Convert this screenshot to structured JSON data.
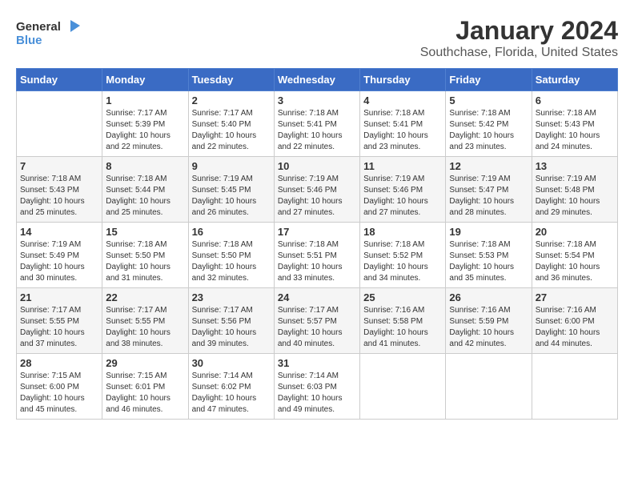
{
  "logo": {
    "name_line1": "General",
    "name_line2": "Blue"
  },
  "title": "January 2024",
  "subtitle": "Southchase, Florida, United States",
  "days_of_week": [
    "Sunday",
    "Monday",
    "Tuesday",
    "Wednesday",
    "Thursday",
    "Friday",
    "Saturday"
  ],
  "weeks": [
    [
      {
        "num": "",
        "info": ""
      },
      {
        "num": "1",
        "info": "Sunrise: 7:17 AM\nSunset: 5:39 PM\nDaylight: 10 hours\nand 22 minutes."
      },
      {
        "num": "2",
        "info": "Sunrise: 7:17 AM\nSunset: 5:40 PM\nDaylight: 10 hours\nand 22 minutes."
      },
      {
        "num": "3",
        "info": "Sunrise: 7:18 AM\nSunset: 5:41 PM\nDaylight: 10 hours\nand 22 minutes."
      },
      {
        "num": "4",
        "info": "Sunrise: 7:18 AM\nSunset: 5:41 PM\nDaylight: 10 hours\nand 23 minutes."
      },
      {
        "num": "5",
        "info": "Sunrise: 7:18 AM\nSunset: 5:42 PM\nDaylight: 10 hours\nand 23 minutes."
      },
      {
        "num": "6",
        "info": "Sunrise: 7:18 AM\nSunset: 5:43 PM\nDaylight: 10 hours\nand 24 minutes."
      }
    ],
    [
      {
        "num": "7",
        "info": "Sunrise: 7:18 AM\nSunset: 5:43 PM\nDaylight: 10 hours\nand 25 minutes."
      },
      {
        "num": "8",
        "info": "Sunrise: 7:18 AM\nSunset: 5:44 PM\nDaylight: 10 hours\nand 25 minutes."
      },
      {
        "num": "9",
        "info": "Sunrise: 7:19 AM\nSunset: 5:45 PM\nDaylight: 10 hours\nand 26 minutes."
      },
      {
        "num": "10",
        "info": "Sunrise: 7:19 AM\nSunset: 5:46 PM\nDaylight: 10 hours\nand 27 minutes."
      },
      {
        "num": "11",
        "info": "Sunrise: 7:19 AM\nSunset: 5:46 PM\nDaylight: 10 hours\nand 27 minutes."
      },
      {
        "num": "12",
        "info": "Sunrise: 7:19 AM\nSunset: 5:47 PM\nDaylight: 10 hours\nand 28 minutes."
      },
      {
        "num": "13",
        "info": "Sunrise: 7:19 AM\nSunset: 5:48 PM\nDaylight: 10 hours\nand 29 minutes."
      }
    ],
    [
      {
        "num": "14",
        "info": "Sunrise: 7:19 AM\nSunset: 5:49 PM\nDaylight: 10 hours\nand 30 minutes."
      },
      {
        "num": "15",
        "info": "Sunrise: 7:18 AM\nSunset: 5:50 PM\nDaylight: 10 hours\nand 31 minutes."
      },
      {
        "num": "16",
        "info": "Sunrise: 7:18 AM\nSunset: 5:50 PM\nDaylight: 10 hours\nand 32 minutes."
      },
      {
        "num": "17",
        "info": "Sunrise: 7:18 AM\nSunset: 5:51 PM\nDaylight: 10 hours\nand 33 minutes."
      },
      {
        "num": "18",
        "info": "Sunrise: 7:18 AM\nSunset: 5:52 PM\nDaylight: 10 hours\nand 34 minutes."
      },
      {
        "num": "19",
        "info": "Sunrise: 7:18 AM\nSunset: 5:53 PM\nDaylight: 10 hours\nand 35 minutes."
      },
      {
        "num": "20",
        "info": "Sunrise: 7:18 AM\nSunset: 5:54 PM\nDaylight: 10 hours\nand 36 minutes."
      }
    ],
    [
      {
        "num": "21",
        "info": "Sunrise: 7:17 AM\nSunset: 5:55 PM\nDaylight: 10 hours\nand 37 minutes."
      },
      {
        "num": "22",
        "info": "Sunrise: 7:17 AM\nSunset: 5:55 PM\nDaylight: 10 hours\nand 38 minutes."
      },
      {
        "num": "23",
        "info": "Sunrise: 7:17 AM\nSunset: 5:56 PM\nDaylight: 10 hours\nand 39 minutes."
      },
      {
        "num": "24",
        "info": "Sunrise: 7:17 AM\nSunset: 5:57 PM\nDaylight: 10 hours\nand 40 minutes."
      },
      {
        "num": "25",
        "info": "Sunrise: 7:16 AM\nSunset: 5:58 PM\nDaylight: 10 hours\nand 41 minutes."
      },
      {
        "num": "26",
        "info": "Sunrise: 7:16 AM\nSunset: 5:59 PM\nDaylight: 10 hours\nand 42 minutes."
      },
      {
        "num": "27",
        "info": "Sunrise: 7:16 AM\nSunset: 6:00 PM\nDaylight: 10 hours\nand 44 minutes."
      }
    ],
    [
      {
        "num": "28",
        "info": "Sunrise: 7:15 AM\nSunset: 6:00 PM\nDaylight: 10 hours\nand 45 minutes."
      },
      {
        "num": "29",
        "info": "Sunrise: 7:15 AM\nSunset: 6:01 PM\nDaylight: 10 hours\nand 46 minutes."
      },
      {
        "num": "30",
        "info": "Sunrise: 7:14 AM\nSunset: 6:02 PM\nDaylight: 10 hours\nand 47 minutes."
      },
      {
        "num": "31",
        "info": "Sunrise: 7:14 AM\nSunset: 6:03 PM\nDaylight: 10 hours\nand 49 minutes."
      },
      {
        "num": "",
        "info": ""
      },
      {
        "num": "",
        "info": ""
      },
      {
        "num": "",
        "info": ""
      }
    ]
  ]
}
